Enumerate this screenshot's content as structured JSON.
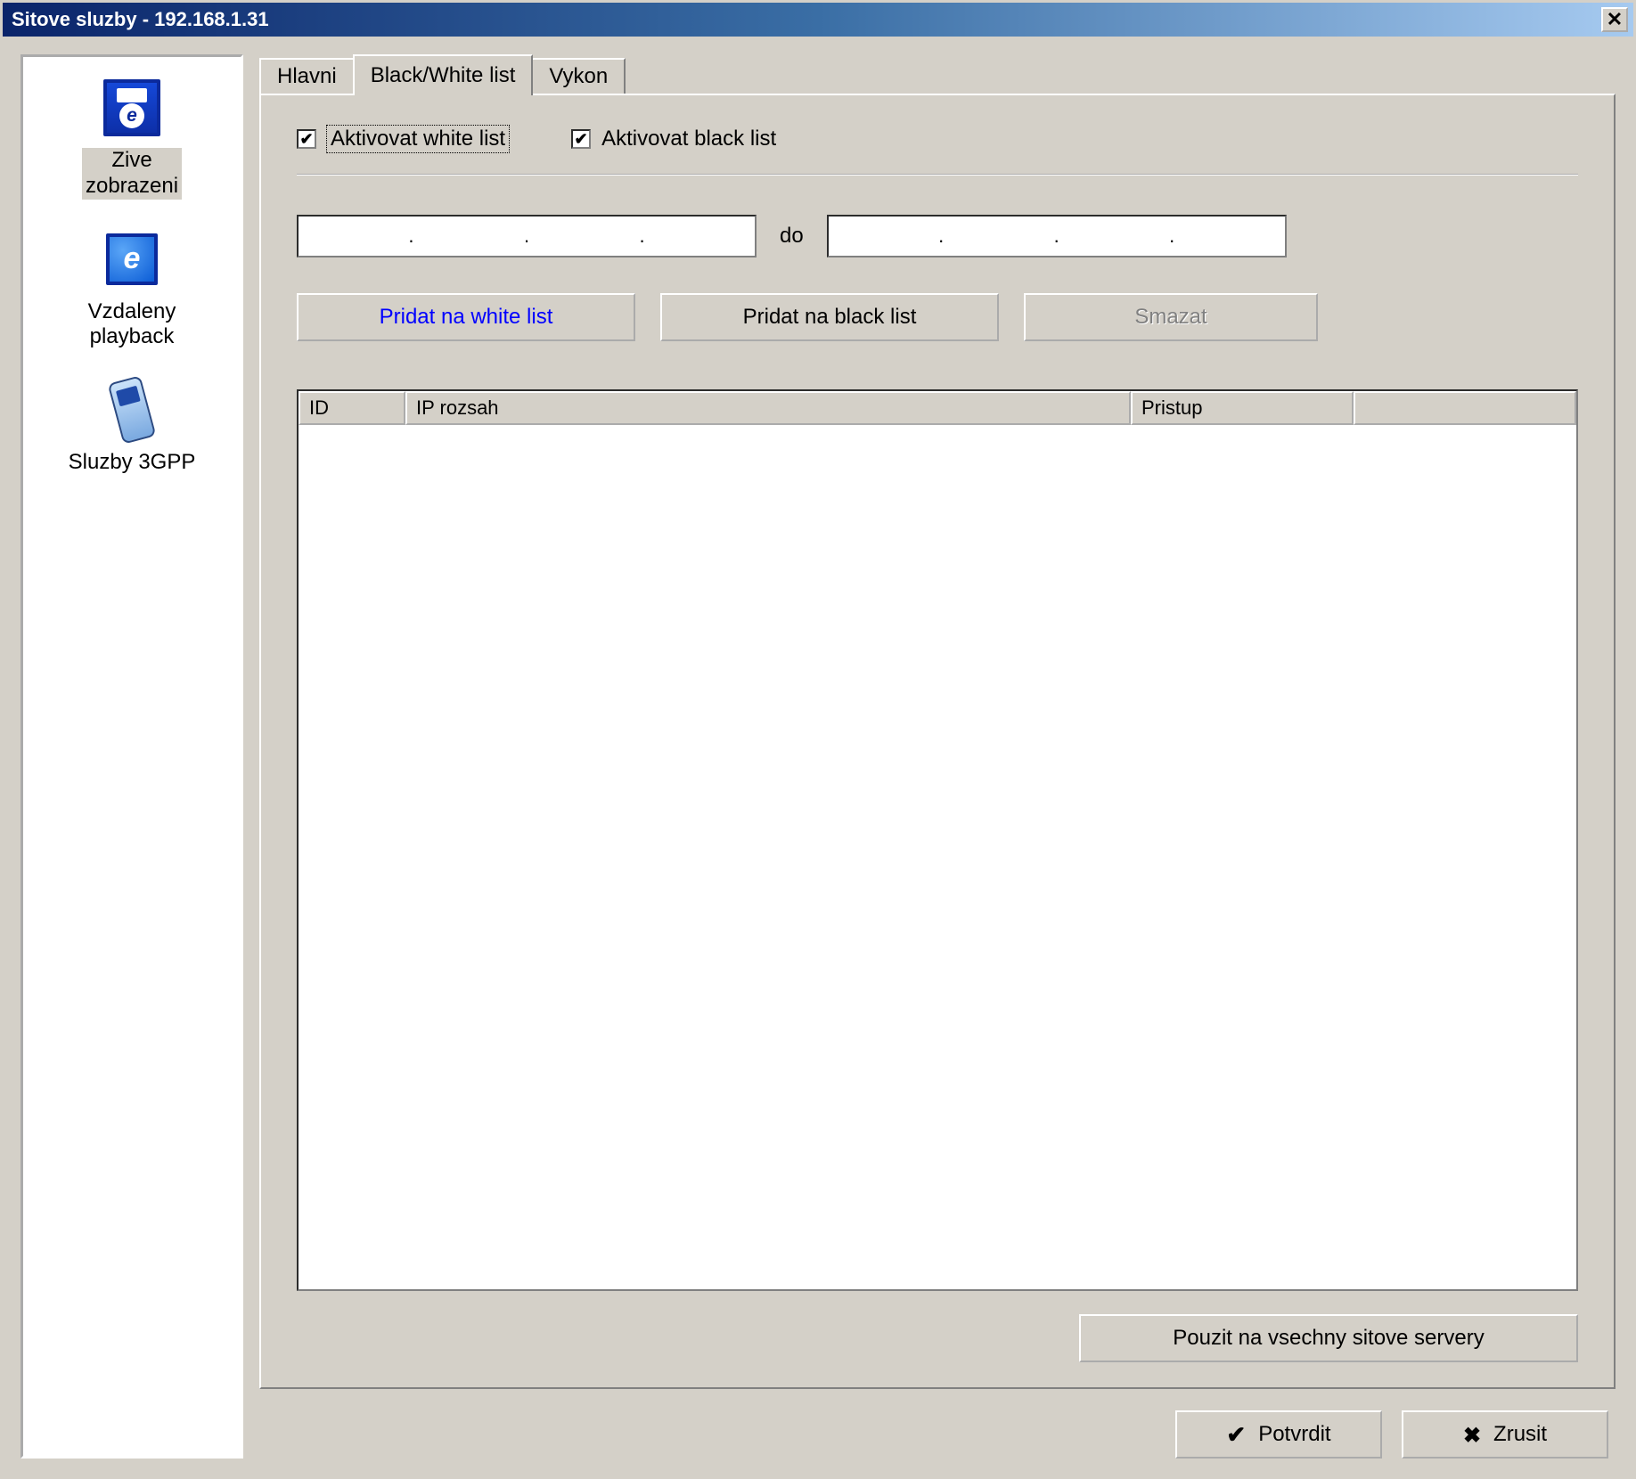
{
  "titlebar": {
    "title": "Sitove sluzby - 192.168.1.31"
  },
  "sidebar": {
    "items": [
      {
        "label": "Zive\nzobrazeni"
      },
      {
        "label": "Vzdaleny\nplayback"
      },
      {
        "label": "Sluzby 3GPP"
      }
    ]
  },
  "tabs": {
    "items": [
      {
        "label": "Hlavni"
      },
      {
        "label": "Black/White list"
      },
      {
        "label": "Vykon"
      }
    ],
    "active_index": 1
  },
  "panel": {
    "activate_white": {
      "label": "Aktivovat white list",
      "checked": true
    },
    "activate_black": {
      "label": "Aktivovat black list",
      "checked": true
    },
    "ip_sep_label": "do",
    "ip_from": "",
    "ip_to": "",
    "btn_add_white": "Pridat na white list",
    "btn_add_black": "Pridat na black list",
    "btn_delete": "Smazat",
    "table": {
      "columns": [
        "ID",
        "IP rozsah",
        "Pristup",
        ""
      ],
      "rows": []
    },
    "btn_apply_all": "Pouzit na vsechny sitove servery"
  },
  "footer": {
    "ok": "Potvrdit",
    "cancel": "Zrusit"
  }
}
